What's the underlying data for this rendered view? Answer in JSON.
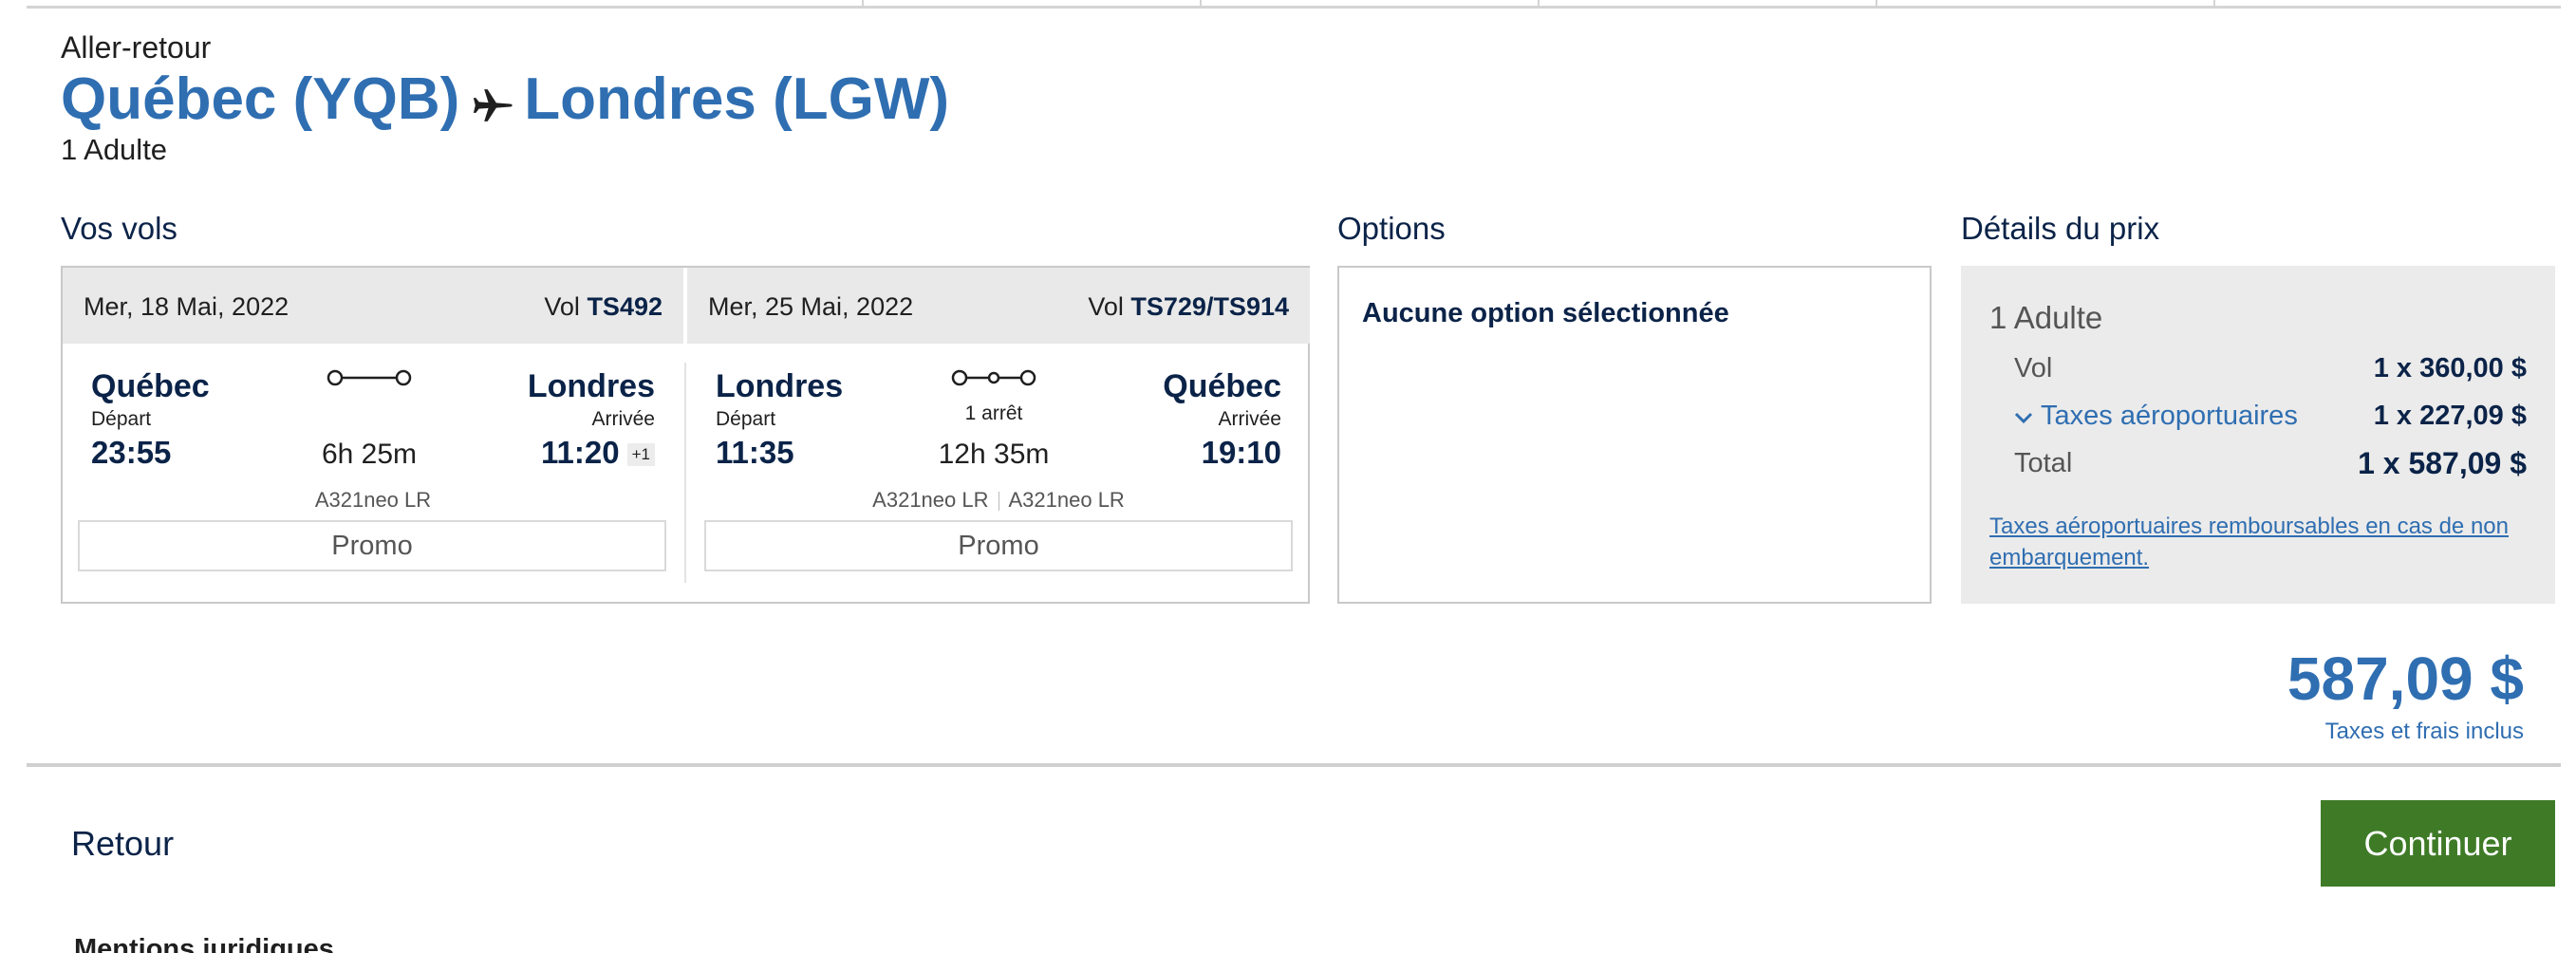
{
  "header": {
    "trip_type": "Aller-retour",
    "origin": "Québec (YQB)",
    "destination": "Londres (LGW)",
    "passengers": "1 Adulte"
  },
  "flights_section": {
    "title": "Vos vols",
    "outbound": {
      "date": "Mer, 18 Mai, 2022",
      "flight_label": "Vol",
      "flight_number": "TS492",
      "from_city": "Québec",
      "from_label": "Départ",
      "from_time": "23:55",
      "to_city": "Londres",
      "to_label": "Arrivée",
      "to_time": "11:20",
      "day_offset": "+1",
      "duration": "6h 25m",
      "aircraft": [
        "A321neo LR"
      ],
      "fare": "Promo"
    },
    "inbound": {
      "date": "Mer, 25 Mai, 2022",
      "flight_label": "Vol",
      "flight_number": "TS729/TS914",
      "from_city": "Londres",
      "from_label": "Départ",
      "from_time": "11:35",
      "to_city": "Québec",
      "to_label": "Arrivée",
      "to_time": "19:10",
      "stops": "1 arrêt",
      "duration": "12h 35m",
      "aircraft": [
        "A321neo LR",
        "A321neo LR"
      ],
      "fare": "Promo"
    }
  },
  "options_section": {
    "title": "Options",
    "empty_text": "Aucune option sélectionnée"
  },
  "price_section": {
    "title": "Détails du prix",
    "passenger_type": "1 Adulte",
    "rows": [
      {
        "label": "Vol",
        "value": "1 x 360,00 $"
      },
      {
        "label": "Taxes aéroportuaires",
        "value": "1 x 227,09 $"
      },
      {
        "label": "Total",
        "value": "1 x 587,09 $"
      }
    ],
    "refund_link": "Taxes aéroportuaires remboursables en cas de non embarquement."
  },
  "total": {
    "amount": "587,09 $",
    "note": "Taxes et frais inclus"
  },
  "footer": {
    "back_label": "Retour",
    "continue_label": "Continuer",
    "legal_title": "Mentions juridiques"
  },
  "colors": {
    "brand_blue": "#2f6eb1",
    "navy": "#0b2348",
    "continue_green": "#3f7b27",
    "panel_gray": "#ebebeb"
  },
  "icons": {
    "route": "airplane-icon",
    "direct": "nonstop-route-icon",
    "one_stop": "one-stop-route-icon",
    "expand": "chevron-down-icon"
  }
}
